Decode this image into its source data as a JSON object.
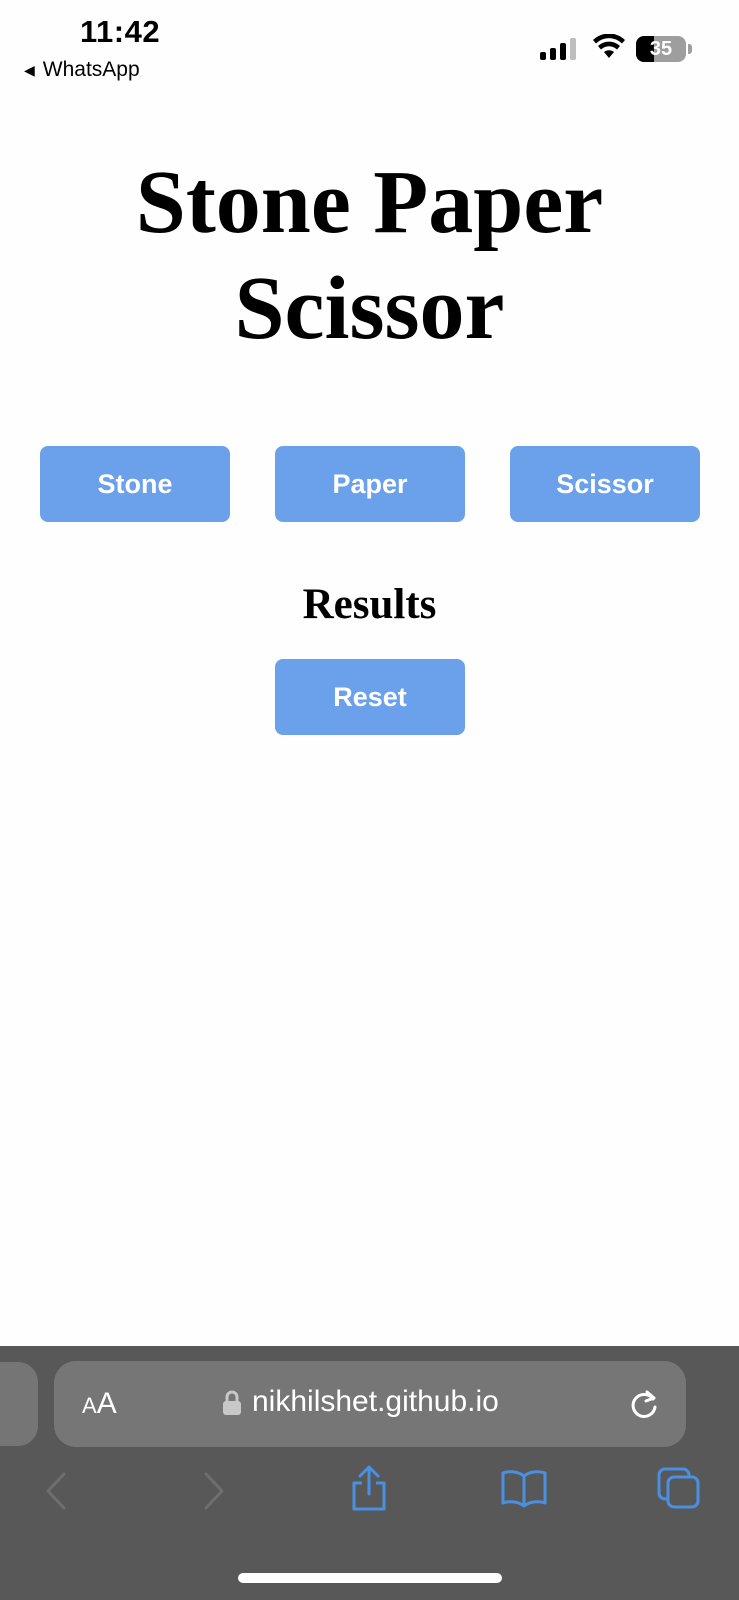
{
  "status_bar": {
    "time": "11:42",
    "back_app": "WhatsApp",
    "battery_percent": "35"
  },
  "page": {
    "title_line1": "Stone Paper",
    "title_line2": "Scissor",
    "buttons": {
      "stone": "Stone",
      "paper": "Paper",
      "scissor": "Scissor"
    },
    "results_heading": "Results",
    "reset_label": "Reset"
  },
  "browser": {
    "text_size_small": "A",
    "text_size_big": "A",
    "url": "nikhilshet.github.io"
  },
  "colors": {
    "button_bg": "#6ba0ea",
    "button_text": "#ffffff",
    "toolbar_bg": "#585858",
    "url_pill_bg": "#767676",
    "toolbar_icon_active": "#4a90e2",
    "toolbar_icon_disabled": "#6e6e6e"
  },
  "icons": {
    "back": "chevron-left-icon",
    "forward": "chevron-right-icon",
    "share": "share-icon",
    "bookmarks": "book-icon",
    "tabs": "tabs-icon",
    "lock": "lock-icon",
    "reload": "reload-icon"
  }
}
